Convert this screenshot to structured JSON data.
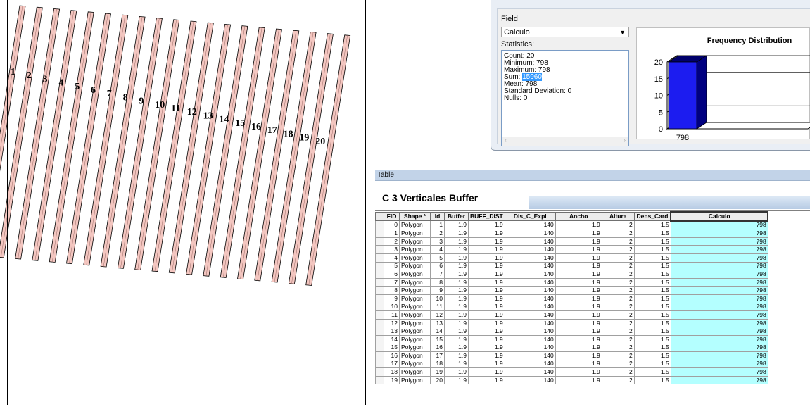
{
  "map": {
    "labels": [
      "1",
      "2",
      "3",
      "4",
      "5",
      "6",
      "7",
      "8",
      "9",
      "10",
      "11",
      "12",
      "13",
      "14",
      "15",
      "16",
      "17",
      "18",
      "19",
      "20"
    ]
  },
  "stats": {
    "field_label": "Field",
    "field_value": "Calculo",
    "statistics_label": "Statistics:",
    "rows": [
      {
        "key": "Count:",
        "value": "20"
      },
      {
        "key": "Minimum:",
        "value": "798"
      },
      {
        "key": "Maximum:",
        "value": "798"
      },
      {
        "key": "Sum:",
        "value": "15960"
      },
      {
        "key": "Mean:",
        "value": "798"
      },
      {
        "key": "Standard Deviation:",
        "value": "0"
      },
      {
        "key": "Nulls:",
        "value": "0"
      }
    ],
    "chart": {
      "title": "Frequency Distribution",
      "y_ticks": [
        "0",
        "5",
        "10",
        "15",
        "20"
      ],
      "bar_value": 20,
      "x_label": "798",
      "bar_color": "#1c1cf0"
    }
  },
  "table": {
    "window_title": "Table",
    "layer_name": "C 3  Verticales  Buffer",
    "columns": [
      "FID",
      "Shape *",
      "Id",
      "Buffer",
      "BUFF_DIST",
      "Dis_C_Expl",
      "Ancho",
      "Altura",
      "Dens_Card",
      "Calculo"
    ],
    "rows": [
      [
        "0",
        "Polygon",
        "1",
        "1.9",
        "1.9",
        "140",
        "1.9",
        "2",
        "1.5",
        "798"
      ],
      [
        "1",
        "Polygon",
        "2",
        "1.9",
        "1.9",
        "140",
        "1.9",
        "2",
        "1.5",
        "798"
      ],
      [
        "2",
        "Polygon",
        "3",
        "1.9",
        "1.9",
        "140",
        "1.9",
        "2",
        "1.5",
        "798"
      ],
      [
        "3",
        "Polygon",
        "4",
        "1.9",
        "1.9",
        "140",
        "1.9",
        "2",
        "1.5",
        "798"
      ],
      [
        "4",
        "Polygon",
        "5",
        "1.9",
        "1.9",
        "140",
        "1.9",
        "2",
        "1.5",
        "798"
      ],
      [
        "5",
        "Polygon",
        "6",
        "1.9",
        "1.9",
        "140",
        "1.9",
        "2",
        "1.5",
        "798"
      ],
      [
        "6",
        "Polygon",
        "7",
        "1.9",
        "1.9",
        "140",
        "1.9",
        "2",
        "1.5",
        "798"
      ],
      [
        "7",
        "Polygon",
        "8",
        "1.9",
        "1.9",
        "140",
        "1.9",
        "2",
        "1.5",
        "798"
      ],
      [
        "8",
        "Polygon",
        "9",
        "1.9",
        "1.9",
        "140",
        "1.9",
        "2",
        "1.5",
        "798"
      ],
      [
        "9",
        "Polygon",
        "10",
        "1.9",
        "1.9",
        "140",
        "1.9",
        "2",
        "1.5",
        "798"
      ],
      [
        "10",
        "Polygon",
        "11",
        "1.9",
        "1.9",
        "140",
        "1.9",
        "2",
        "1.5",
        "798"
      ],
      [
        "11",
        "Polygon",
        "12",
        "1.9",
        "1.9",
        "140",
        "1.9",
        "2",
        "1.5",
        "798"
      ],
      [
        "12",
        "Polygon",
        "13",
        "1.9",
        "1.9",
        "140",
        "1.9",
        "2",
        "1.5",
        "798"
      ],
      [
        "13",
        "Polygon",
        "14",
        "1.9",
        "1.9",
        "140",
        "1.9",
        "2",
        "1.5",
        "798"
      ],
      [
        "14",
        "Polygon",
        "15",
        "1.9",
        "1.9",
        "140",
        "1.9",
        "2",
        "1.5",
        "798"
      ],
      [
        "15",
        "Polygon",
        "16",
        "1.9",
        "1.9",
        "140",
        "1.9",
        "2",
        "1.5",
        "798"
      ],
      [
        "16",
        "Polygon",
        "17",
        "1.9",
        "1.9",
        "140",
        "1.9",
        "2",
        "1.5",
        "798"
      ],
      [
        "17",
        "Polygon",
        "18",
        "1.9",
        "1.9",
        "140",
        "1.9",
        "2",
        "1.5",
        "798"
      ],
      [
        "18",
        "Polygon",
        "19",
        "1.9",
        "1.9",
        "140",
        "1.9",
        "2",
        "1.5",
        "798"
      ],
      [
        "19",
        "Polygon",
        "20",
        "1.9",
        "1.9",
        "140",
        "1.9",
        "2",
        "1.5",
        "798"
      ]
    ]
  }
}
